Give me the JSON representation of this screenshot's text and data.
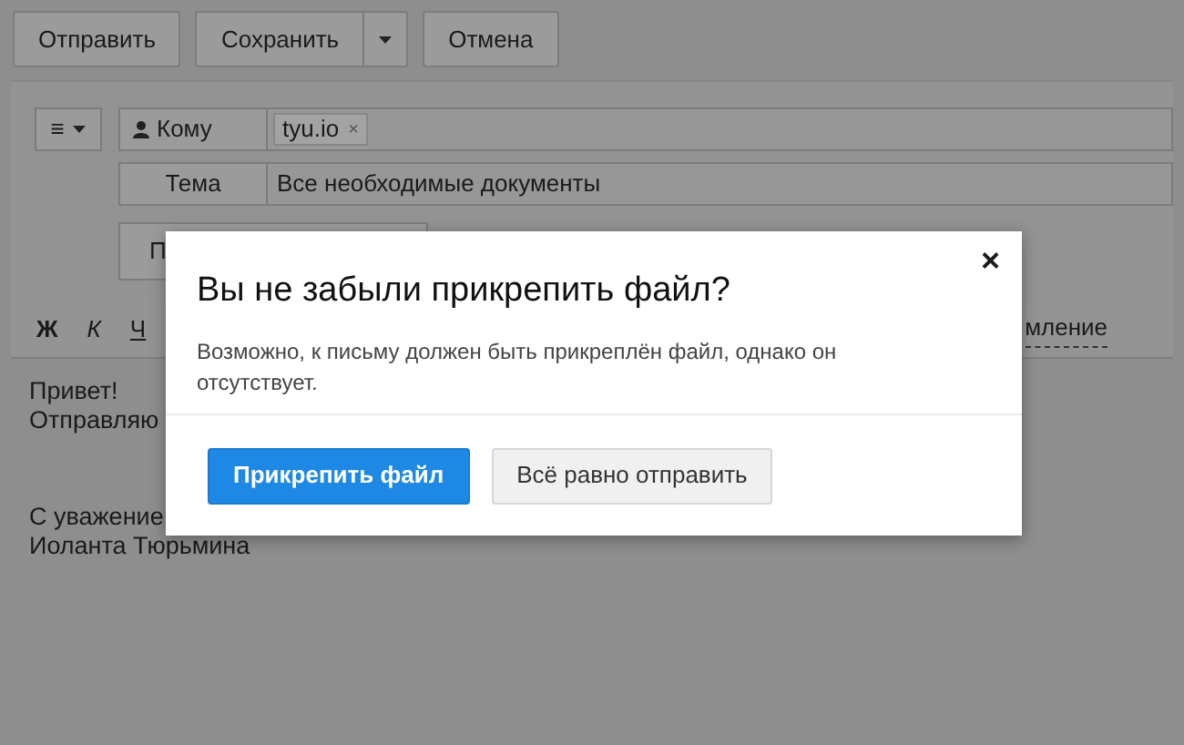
{
  "toolbar": {
    "buttons": [
      {
        "label": "Отправить",
        "kind": "plain"
      },
      {
        "label": "Сохранить",
        "kind": "split"
      },
      {
        "label": "Отмена",
        "kind": "plain"
      }
    ]
  },
  "compose": {
    "menu_button": {
      "label": "≡"
    },
    "to": {
      "label": "Кому",
      "recipients": [
        "tyu.io"
      ],
      "remove": "×"
    },
    "subject": {
      "label": "Тема",
      "value": "Все необходимые документы"
    },
    "row_3": {
      "label": "П"
    }
  },
  "format_bar": {
    "items": [
      {
        "label": "Ж",
        "kind": "bold"
      },
      {
        "label": "К",
        "kind": "italic"
      },
      {
        "label": "Ч",
        "kind": "underline"
      }
    ],
    "link": "мление"
  },
  "body": {
    "paragraphs": [
      [
        "Привет!",
        "Отправляю"
      ],
      [
        "С уважение",
        "Иоланта Тюрьмина"
      ]
    ]
  },
  "dialog": {
    "title": "Вы не забыли прикрепить файл?",
    "close": "×",
    "message": "Возможно, к письму должен быть прикреплён файл, однако он отсутствует.",
    "buttons": [
      {
        "label": "Прикрепить файл",
        "kind": "primary"
      },
      {
        "label": "Всё равно отправить",
        "kind": "secondary"
      }
    ]
  }
}
